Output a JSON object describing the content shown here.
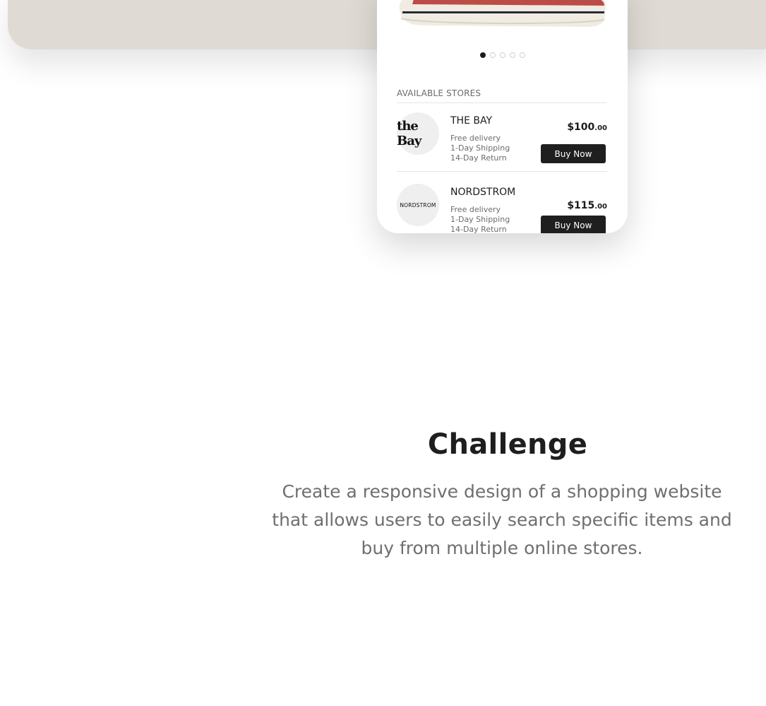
{
  "carousel": {
    "total_slides": 5,
    "active_index": 0
  },
  "stores": {
    "heading": "AVAILABLE STORES",
    "items": [
      {
        "logo_text": "the Bay",
        "name": "THE BAY",
        "features": [
          "Free delivery",
          "1-Day Shipping",
          "14-Day Return"
        ],
        "price_main": "$100",
        "price_cents": ".00",
        "button_label": "Buy Now"
      },
      {
        "logo_text": "NORDSTROM",
        "name": "NORDSTROM",
        "features": [
          "Free delivery",
          "1-Day Shipping",
          "14-Day Return"
        ],
        "price_main": "$115",
        "price_cents": ".00",
        "button_label": "Buy Now"
      }
    ]
  },
  "challenge": {
    "title": "Challenge",
    "body": "Create a responsive design of a shopping website that allows users to easily search specific items and buy from multiple online stores."
  },
  "colors": {
    "hero_band": "#dfdbd4",
    "button_bg": "#1f1f1f",
    "accent_red": "#b3302c"
  }
}
